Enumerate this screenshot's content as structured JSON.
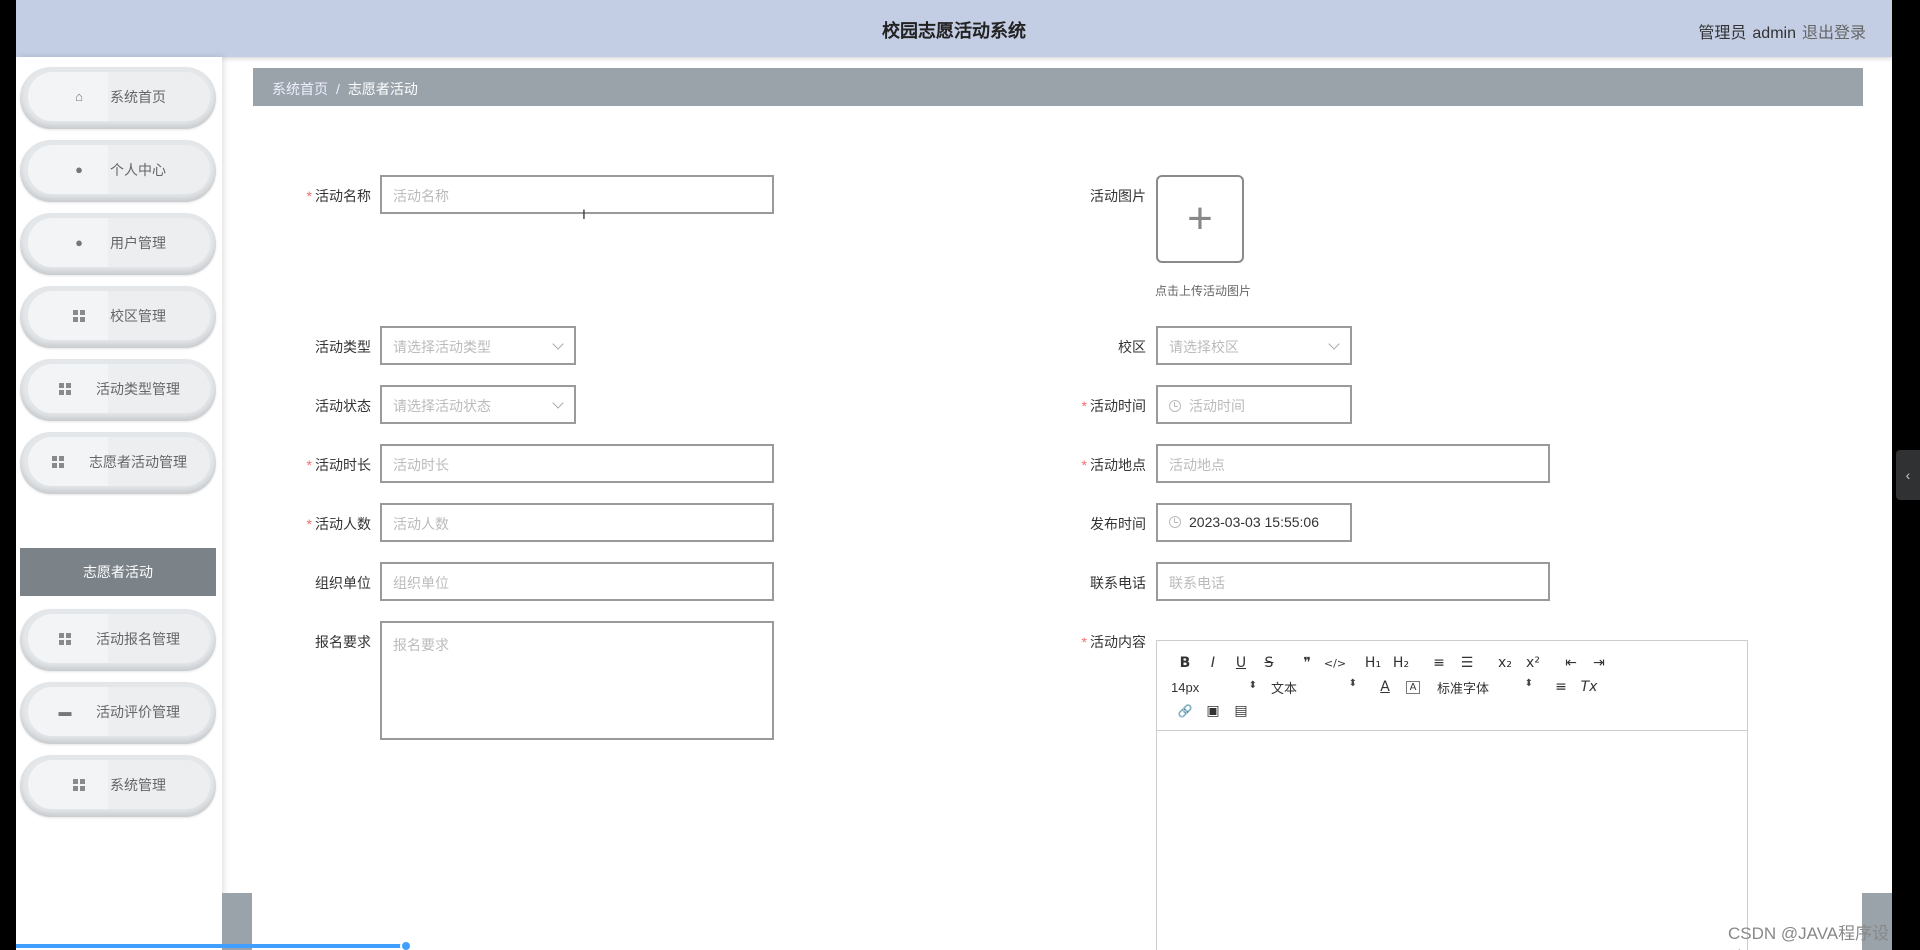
{
  "header": {
    "title": "校园志愿活动系统",
    "role": "管理员",
    "username": "admin",
    "logout": "退出登录"
  },
  "sidebar": {
    "items": [
      {
        "label": "系统首页",
        "icon": "home-icon"
      },
      {
        "label": "个人中心",
        "icon": "user-icon"
      },
      {
        "label": "用户管理",
        "icon": "user-icon"
      },
      {
        "label": "校区管理",
        "icon": "grid-icon"
      },
      {
        "label": "活动类型管理",
        "icon": "grid-icon"
      },
      {
        "label": "志愿者活动管理",
        "icon": "grid-icon"
      },
      {
        "label": "活动报名管理",
        "icon": "grid-icon"
      },
      {
        "label": "活动评价管理",
        "icon": "comment-icon"
      },
      {
        "label": "系统管理",
        "icon": "grid-icon"
      }
    ],
    "active_sub": "志愿者活动"
  },
  "breadcrumb": {
    "home": "系统首页",
    "current": "志愿者活动",
    "separator": "/"
  },
  "form": {
    "name": {
      "label": "活动名称",
      "placeholder": "活动名称"
    },
    "image": {
      "label": "活动图片",
      "tip": "点击上传活动图片"
    },
    "type": {
      "label": "活动类型",
      "placeholder": "请选择活动类型"
    },
    "campus": {
      "label": "校区",
      "placeholder": "请选择校区"
    },
    "status": {
      "label": "活动状态",
      "placeholder": "请选择活动状态"
    },
    "time": {
      "label": "活动时间",
      "placeholder": "活动时间"
    },
    "duration": {
      "label": "活动时长",
      "placeholder": "活动时长"
    },
    "location": {
      "label": "活动地点",
      "placeholder": "活动地点"
    },
    "people": {
      "label": "活动人数",
      "placeholder": "活动人数"
    },
    "publish_time": {
      "label": "发布时间",
      "value": "2023-03-03 15:55:06"
    },
    "org": {
      "label": "组织单位",
      "placeholder": "组织单位"
    },
    "phone": {
      "label": "联系电话",
      "placeholder": "联系电话"
    },
    "requirement": {
      "label": "报名要求",
      "placeholder": "报名要求"
    },
    "content": {
      "label": "活动内容"
    }
  },
  "editor": {
    "bold": "B",
    "italic": "I",
    "underline": "U",
    "strike": "S",
    "quote": "❞",
    "code": "</>",
    "h1": "H₁",
    "h2": "H₂",
    "ol": "≡",
    "ul": "☰",
    "sub": "x₂",
    "sup": "x²",
    "outdent": "⇤",
    "indent": "⇥",
    "size": "14px",
    "block": "文本",
    "color": "A",
    "bg": "A",
    "font": "标准字体",
    "align": "≡",
    "clean": "Tx",
    "link": "🔗",
    "image": "▣",
    "video": "▤"
  },
  "watermark": "CSDN @JAVA程序设计"
}
